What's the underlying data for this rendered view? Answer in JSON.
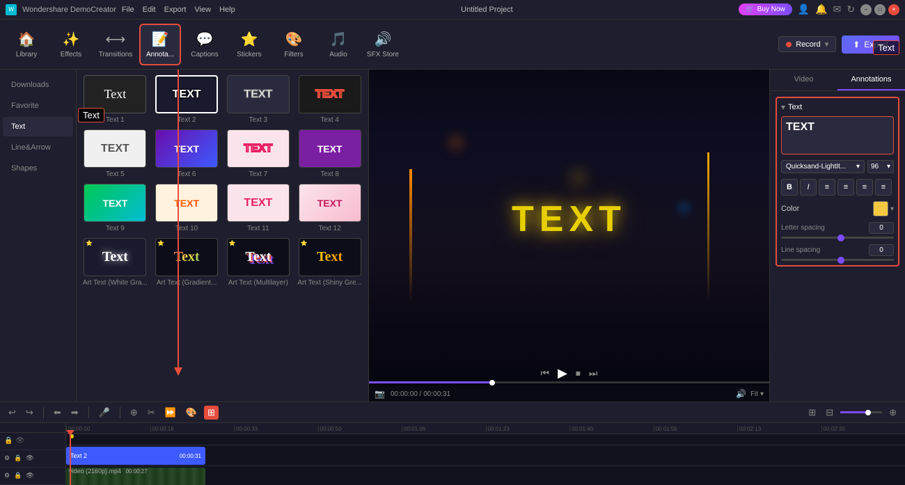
{
  "app": {
    "title": "Wondershare DemoCreator",
    "project_title": "Untitled Project",
    "version": "DemoCreator"
  },
  "titlebar": {
    "menus": [
      "File",
      "Edit",
      "Export",
      "View",
      "Help"
    ],
    "buy_now": "Buy Now",
    "win_controls": [
      "−",
      "□",
      "×"
    ]
  },
  "toolbar": {
    "items": [
      {
        "id": "library",
        "label": "Library",
        "icon": "🏠"
      },
      {
        "id": "effects",
        "label": "Effects",
        "icon": "✨"
      },
      {
        "id": "transitions",
        "label": "Transitions",
        "icon": "⟷"
      },
      {
        "id": "annotations",
        "label": "Annota...",
        "icon": "📝"
      },
      {
        "id": "captions",
        "label": "Captions",
        "icon": "💬"
      },
      {
        "id": "stickers",
        "label": "Stickers",
        "icon": "⭐"
      },
      {
        "id": "filters",
        "label": "Filters",
        "icon": "🎨"
      },
      {
        "id": "audio",
        "label": "Audio",
        "icon": "🎵"
      },
      {
        "id": "sfx",
        "label": "SFX Store",
        "icon": "🔊"
      }
    ],
    "active": "annotations",
    "record_label": "Record",
    "export_label": "Export"
  },
  "sidebar": {
    "items": [
      {
        "id": "downloads",
        "label": "Downloads"
      },
      {
        "id": "favorite",
        "label": "Favorite"
      },
      {
        "id": "text",
        "label": "Text"
      },
      {
        "id": "line_arrow",
        "label": "Line&Arrow"
      },
      {
        "id": "shapes",
        "label": "Shapes"
      }
    ],
    "active": "text"
  },
  "text_presets": [
    {
      "id": 1,
      "label": "Text 1",
      "style": "simple_white",
      "text": "Text"
    },
    {
      "id": 2,
      "label": "Text 2",
      "style": "outlined_dark",
      "text": "TEXT",
      "selected": true
    },
    {
      "id": 3,
      "label": "Text 3",
      "style": "outlined_light",
      "text": "TEXT"
    },
    {
      "id": 4,
      "label": "Text 4",
      "style": "outlined_pink",
      "text": "TEXT"
    },
    {
      "id": 5,
      "label": "Text 5",
      "style": "white_box",
      "text": "TEXT"
    },
    {
      "id": 6,
      "label": "Text 6",
      "style": "purple_gradient",
      "text": "TEXT"
    },
    {
      "id": 7,
      "label": "Text 7",
      "style": "pink_outline",
      "text": "TEXT"
    },
    {
      "id": 8,
      "label": "Text 8",
      "style": "purple_filled",
      "text": "TEXT"
    },
    {
      "id": 9,
      "label": "Text 9",
      "style": "green_gradient",
      "text": "TEXT"
    },
    {
      "id": 10,
      "label": "Text 10",
      "style": "orange_3d",
      "text": "TEXT"
    },
    {
      "id": 11,
      "label": "Text 11",
      "style": "pink_simple",
      "text": "TEXT"
    },
    {
      "id": 12,
      "label": "Text 12",
      "style": "pink_gradient",
      "text": "TEXT"
    },
    {
      "id": "art1",
      "label": "Art Text (White Gra...",
      "style": "art_white",
      "text": "Text"
    },
    {
      "id": "art2",
      "label": "Art Text (Gradient...",
      "style": "art_gradient",
      "text": "Text"
    },
    {
      "id": "art3",
      "label": "Art Text (Multilayer)",
      "style": "art_multi",
      "text": "Text"
    },
    {
      "id": "art4",
      "label": "Art Text (Shiny Gre...",
      "style": "art_shiny",
      "text": "Text"
    }
  ],
  "preview": {
    "overlay_text": "TEXT",
    "time_current": "00:00:00",
    "time_total": "00:00:31",
    "zoom_label": "Fit"
  },
  "right_panel": {
    "tabs": [
      "Video",
      "Annotations"
    ],
    "active_tab": "Annotations",
    "text_section_header": "Text",
    "text_content": "TEXT",
    "font_name": "Quicksand-LightIt...",
    "font_size": "96",
    "format_buttons": [
      "B",
      "I",
      "≡",
      "≡",
      "≡",
      "≡"
    ],
    "color_label": "Color",
    "letter_spacing_label": "Letter spacing",
    "letter_spacing_value": "0",
    "line_spacing_label": "Line spacing",
    "line_spacing_value": "0"
  },
  "timeline": {
    "toolbar_buttons": [
      "↩",
      "↪",
      "⬅",
      "➡",
      "🎤",
      "⊕",
      "⊞",
      "⊟",
      "✂",
      "☁",
      "☁"
    ],
    "active_btn_index": 10,
    "zoom_level": "60",
    "tracks": [
      {
        "id": "text_track",
        "label": "Text 2",
        "type": "text",
        "start_time": "00:00:31"
      },
      {
        "id": "video_track",
        "label": "video (2160p).mp4",
        "type": "video",
        "start_time": "00:00:27"
      }
    ],
    "ruler_marks": [
      "00:00:00",
      "00:00:16:0",
      "00:00:33:10",
      "00:00:50:05",
      "00:01:06:20",
      "00:01:23:15",
      "00:01:40:00",
      "00:01:56:20",
      "00:02:13:10",
      "00:02:30:00"
    ]
  },
  "annotations": {
    "text_label_1": "Text",
    "text_label_2": "Text"
  },
  "colors": {
    "accent_red": "#e74c3c",
    "accent_purple": "#7c4dff",
    "accent_blue": "#3d5afe",
    "text_yellow": "#e8d000",
    "bg_dark": "#1e1e2e",
    "color_swatch": "#f5c842"
  }
}
